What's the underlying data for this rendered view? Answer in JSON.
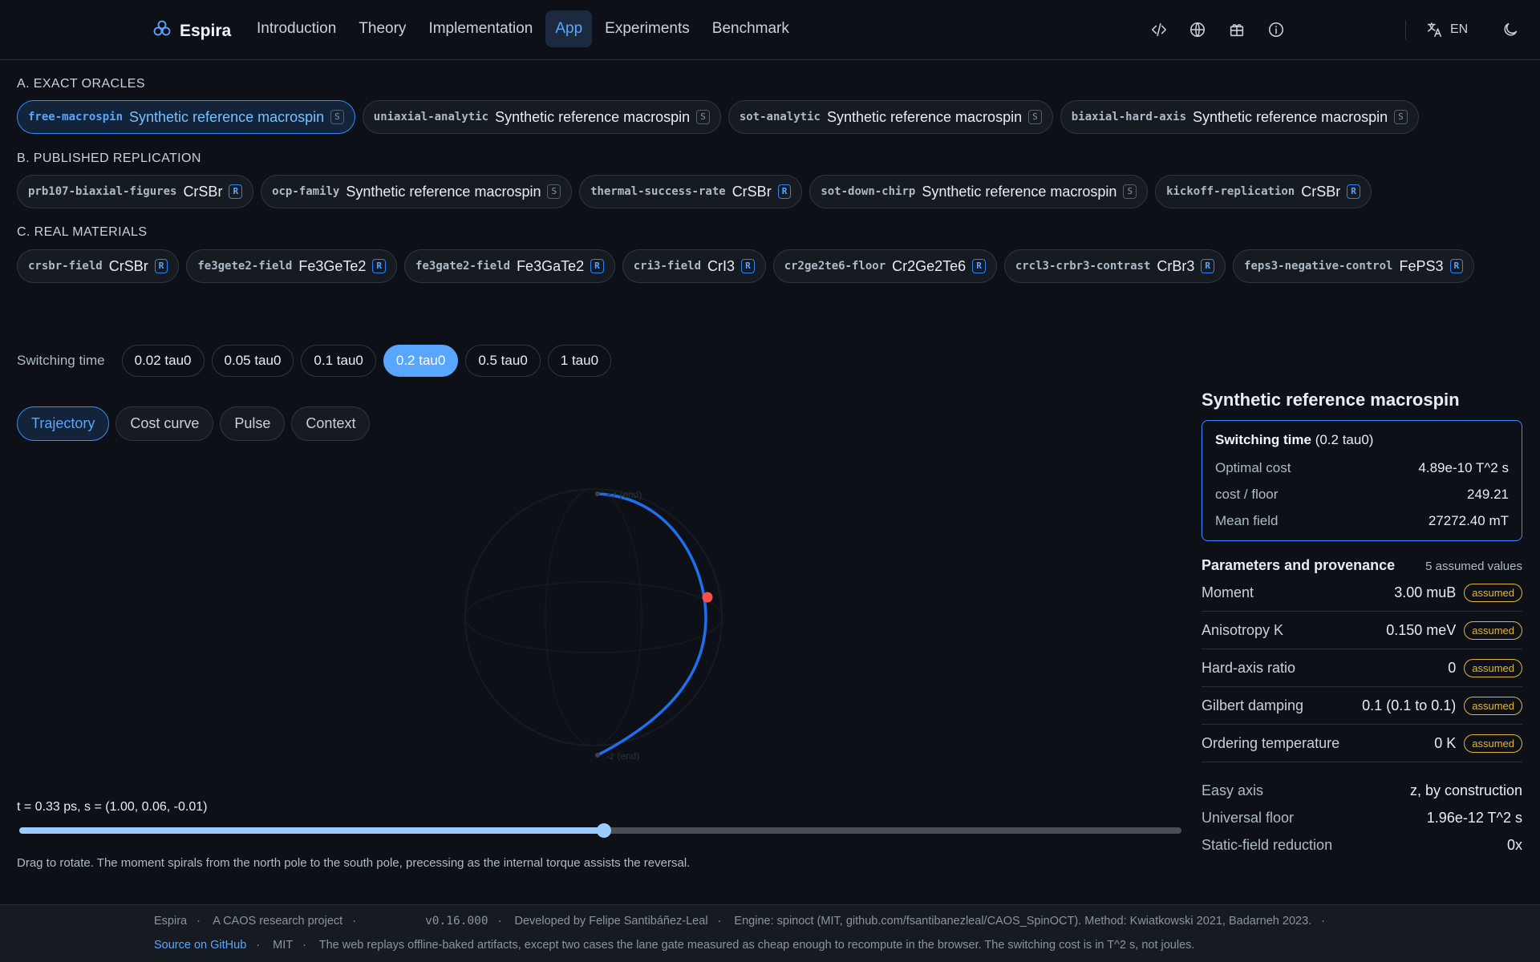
{
  "nav": {
    "brand": "Espira",
    "links": [
      "Introduction",
      "Theory",
      "Implementation",
      "App",
      "Experiments",
      "Benchmark"
    ],
    "active": "App",
    "lang": "EN"
  },
  "sections": {
    "exact": {
      "heading": "A. EXACT ORACLES",
      "chips": [
        {
          "id": "free-macrospin",
          "name": "Synthetic reference macrospin",
          "tag": "S"
        },
        {
          "id": "uniaxial-analytic",
          "name": "Synthetic reference macrospin",
          "tag": "S"
        },
        {
          "id": "sot-analytic",
          "name": "Synthetic reference macrospin",
          "tag": "S"
        },
        {
          "id": "biaxial-hard-axis",
          "name": "Synthetic reference macrospin",
          "tag": "S"
        }
      ]
    },
    "published": {
      "heading": "B. PUBLISHED REPLICATION",
      "chips": [
        {
          "id": "prb107-biaxial-figures",
          "name": "CrSBr",
          "tag": "R"
        },
        {
          "id": "ocp-family",
          "name": "Synthetic reference macrospin",
          "tag": "S"
        },
        {
          "id": "thermal-success-rate",
          "name": "CrSBr",
          "tag": "R"
        },
        {
          "id": "sot-down-chirp",
          "name": "Synthetic reference macrospin",
          "tag": "S"
        },
        {
          "id": "kickoff-replication",
          "name": "CrSBr",
          "tag": "R"
        }
      ]
    },
    "real": {
      "heading": "C. REAL MATERIALS",
      "chips": [
        {
          "id": "crsbr-field",
          "name": "CrSBr",
          "tag": "R"
        },
        {
          "id": "fe3gete2-field",
          "name": "Fe3GeTe2",
          "tag": "R"
        },
        {
          "id": "fe3gate2-field",
          "name": "Fe3GaTe2",
          "tag": "R"
        },
        {
          "id": "cri3-field",
          "name": "CrI3",
          "tag": "R"
        },
        {
          "id": "cr2ge2te6-floor",
          "name": "Cr2Ge2Te6",
          "tag": "R"
        },
        {
          "id": "crcl3-crbr3-contrast",
          "name": "CrBr3",
          "tag": "R"
        },
        {
          "id": "feps3-negative-control",
          "name": "FePS3",
          "tag": "R"
        }
      ]
    }
  },
  "selected_chip": "free-macrospin",
  "switching": {
    "label": "Switching time",
    "options": [
      "0.02 tau0",
      "0.05 tau0",
      "0.1 tau0",
      "0.2 tau0",
      "0.5 tau0",
      "1 tau0"
    ],
    "active": "0.2 tau0"
  },
  "view_tabs": {
    "tabs": [
      "Trajectory",
      "Cost curve",
      "Pulse",
      "Context"
    ],
    "active": "Trajectory"
  },
  "sphere": {
    "start_label": "+z (end)",
    "end_label": "-z (end)",
    "trajectory_color": "#1f6feb",
    "marker_color": "#f85149"
  },
  "time_readout": "t = 0.33 ps, s = (1.00, 0.06, -0.01)",
  "slider": {
    "fraction": 0.503
  },
  "help_text": "Drag to rotate. The moment spirals from the north pole to the south pole, precessing as the internal torque assists the reversal.",
  "panel": {
    "title": "Synthetic reference macrospin",
    "summary": {
      "head_bold": "Switching time",
      "head_rest": " (0.2 tau0)",
      "rows": [
        {
          "k": "Optimal cost",
          "v": "4.89e-10 T^2 s"
        },
        {
          "k": "cost / floor",
          "v": "249.21"
        },
        {
          "k": "Mean field",
          "v": "27272.40 mT"
        }
      ]
    },
    "params": {
      "title": "Parameters and provenance",
      "count": "5 assumed values",
      "badge": "assumed",
      "rows": [
        {
          "k": "Moment",
          "v": "3.00 muB"
        },
        {
          "k": "Anisotropy K",
          "v": "0.150 meV"
        },
        {
          "k": "Hard-axis ratio",
          "v": "0"
        },
        {
          "k": "Gilbert damping",
          "v": "0.1 (0.1 to 0.1)"
        },
        {
          "k": "Ordering temperature",
          "v": "0 K"
        }
      ]
    },
    "facts": [
      {
        "k": "Easy axis",
        "v": "z, by construction"
      },
      {
        "k": "Universal floor",
        "v": "1.96e-12 T^2 s"
      },
      {
        "k": "Static-field reduction",
        "v": "0x"
      }
    ]
  },
  "footer": {
    "line1": [
      "Espira",
      "A CAOS research project",
      "v0.16.000",
      "Developed by Felipe Santibáñez-Leal",
      "Engine: spinoct (MIT, github.com/fsantibanezleal/CAOS_SpinOCT). Method: Kwiatkowski 2021, Badarneh 2023."
    ],
    "link": "Source on GitHub",
    "license": "MIT",
    "note": "The web replays offline-baked artifacts, except two cases the lane gate measured as cheap enough to recompute in the browser. The switching cost is in T^2 s, not joules."
  },
  "colors": {
    "accent": "#58a6ff",
    "assumed": "#e3b341",
    "background": "#0d1117"
  }
}
